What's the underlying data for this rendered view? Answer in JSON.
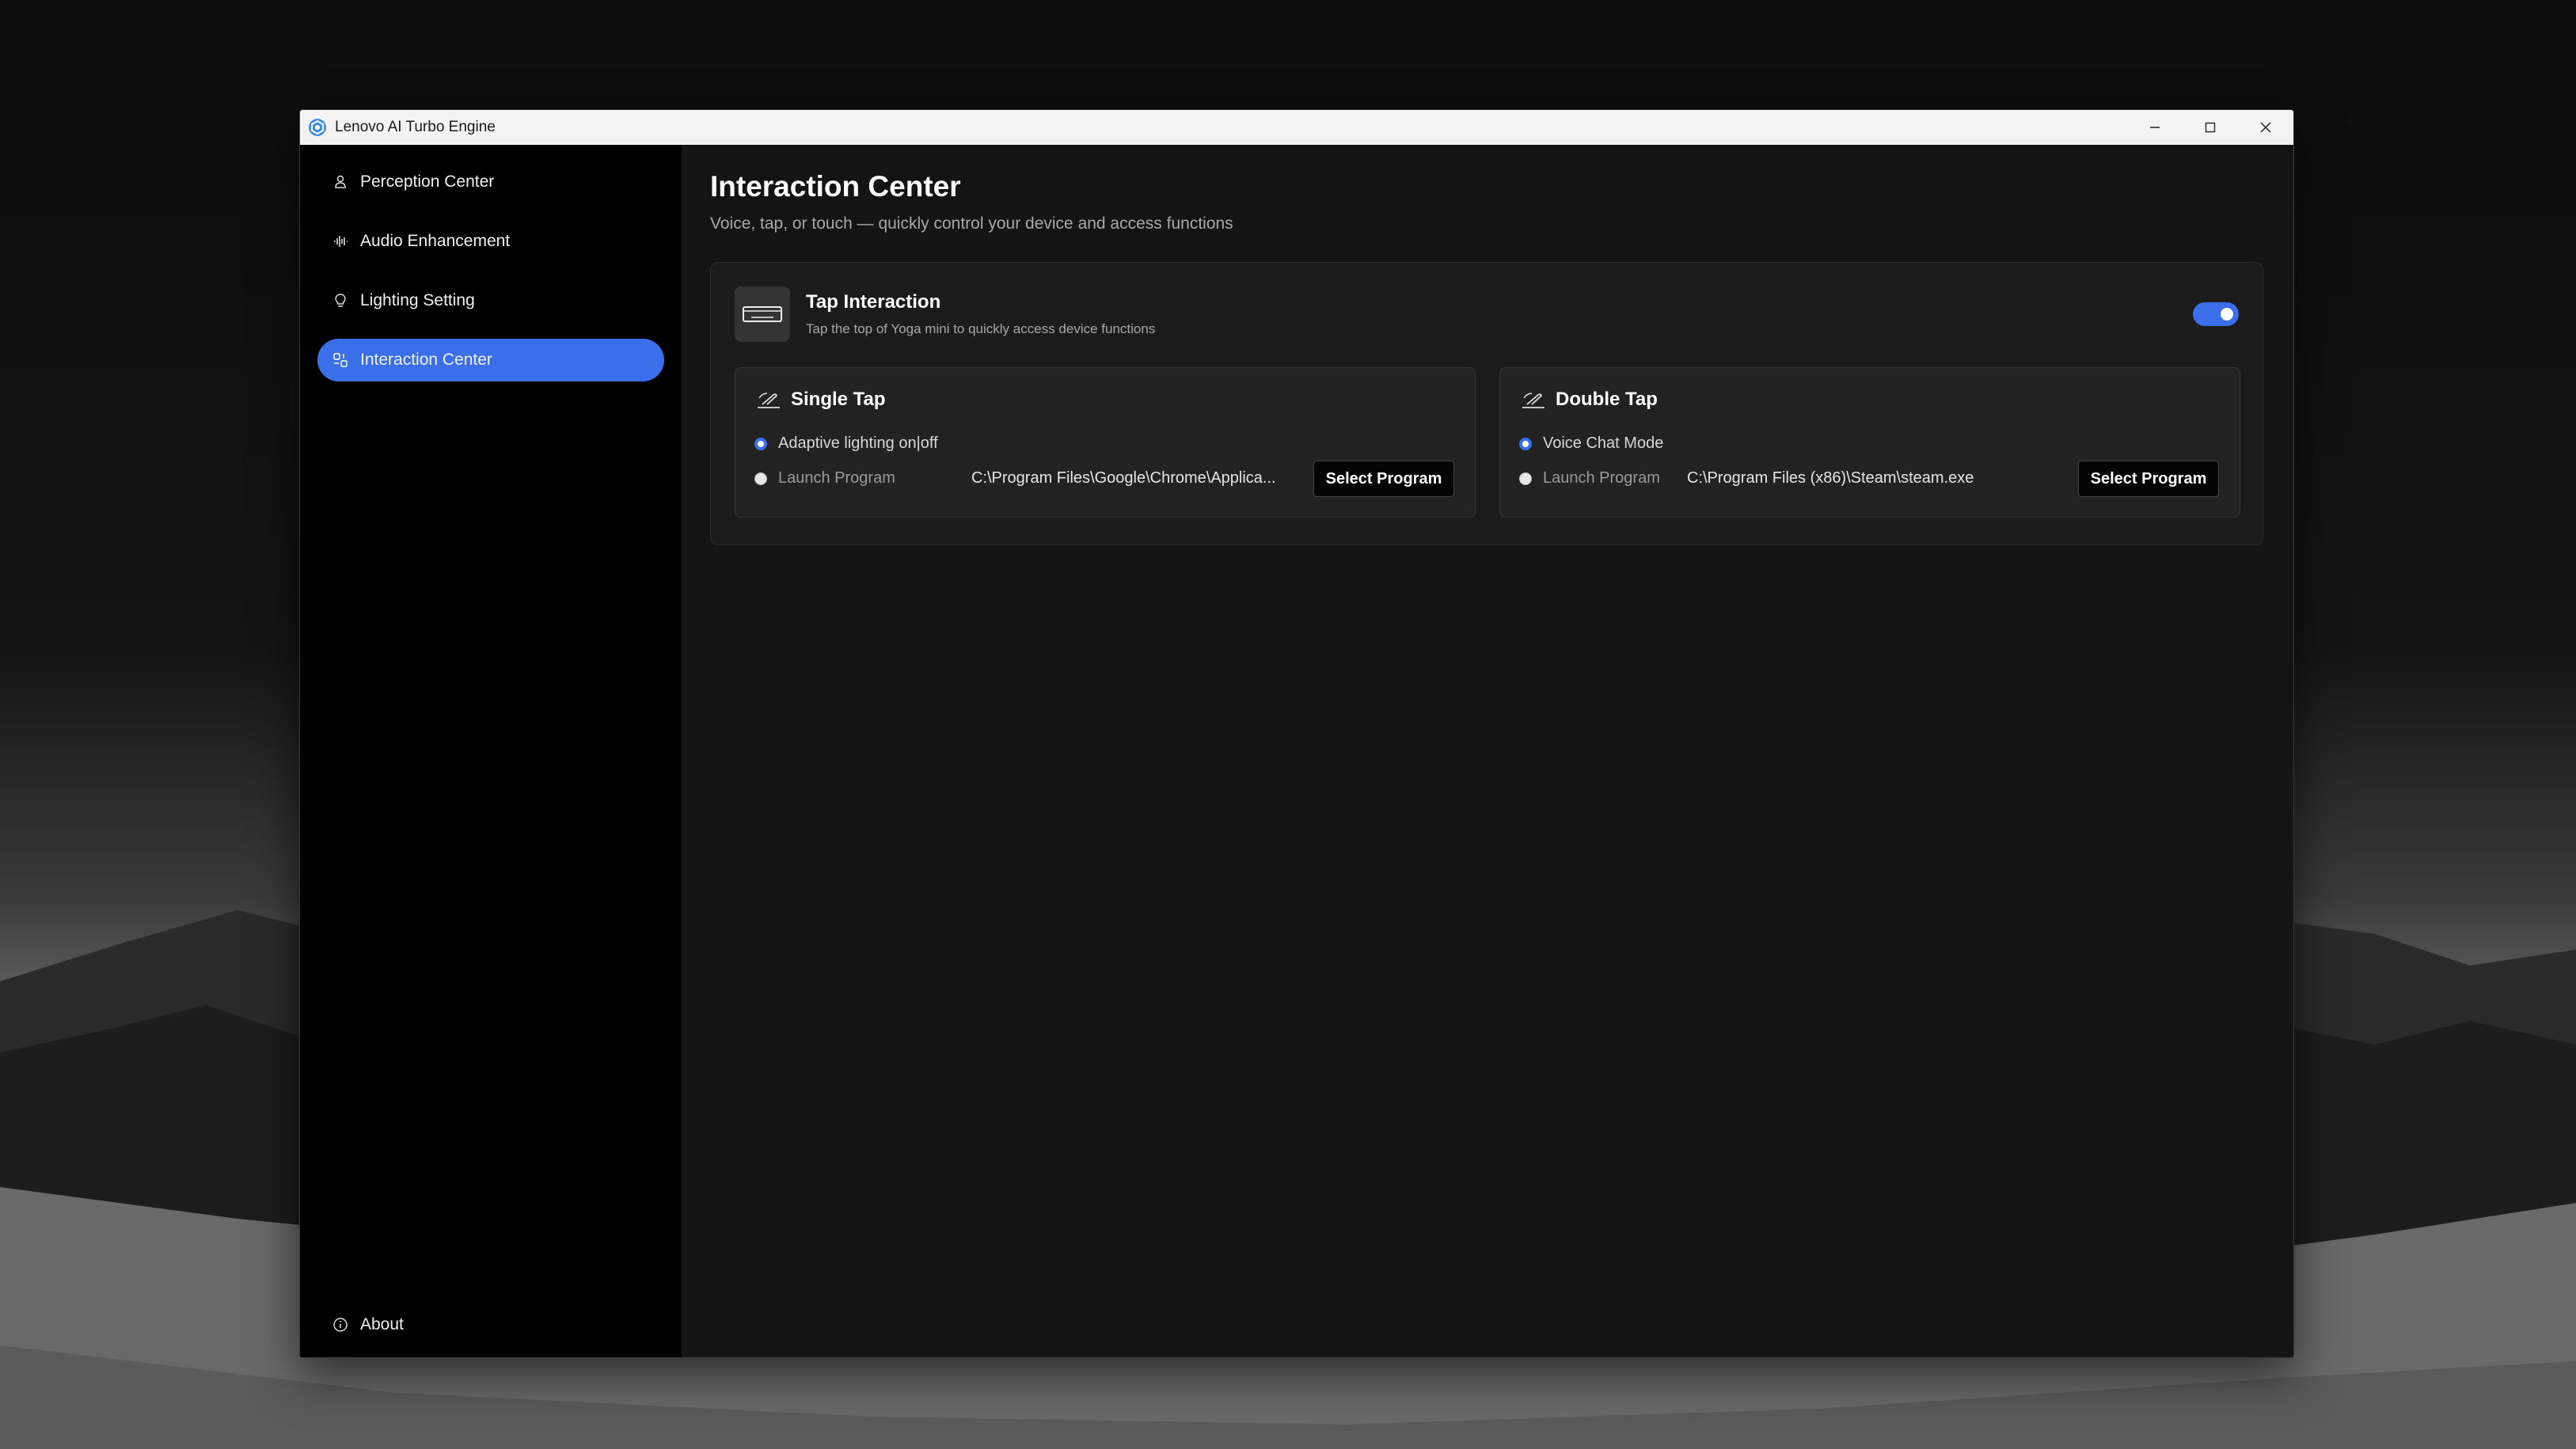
{
  "window": {
    "title": "Lenovo AI Turbo Engine"
  },
  "sidebar": {
    "items": [
      {
        "label": "Perception Center",
        "icon": "person-icon"
      },
      {
        "label": "Audio Enhancement",
        "icon": "audio-wave-icon"
      },
      {
        "label": "Lighting Setting",
        "icon": "bulb-icon"
      },
      {
        "label": "Interaction Center",
        "icon": "interaction-icon",
        "active": true
      }
    ],
    "about": {
      "label": "About",
      "icon": "info-icon"
    }
  },
  "main": {
    "title": "Interaction Center",
    "subtitle": "Voice, tap, or touch — quickly control your device and access functions",
    "tap_interaction": {
      "title": "Tap Interaction",
      "description": "Tap the top of Yoga mini to quickly access device functions",
      "enabled": true
    },
    "single_tap": {
      "title": "Single Tap",
      "option1": "Adaptive lighting on|off",
      "option2": "Launch Program",
      "path": "C:\\Program Files\\Google\\Chrome\\Applica...",
      "button": "Select Program"
    },
    "double_tap": {
      "title": "Double Tap",
      "option1": "Voice Chat Mode",
      "option2": "Launch Program",
      "path": "C:\\Program Files (x86)\\Steam\\steam.exe",
      "button": "Select Program"
    }
  },
  "colors": {
    "accent": "#3b6fea",
    "window_bg": "#141414",
    "sidebar_bg": "#000000"
  }
}
